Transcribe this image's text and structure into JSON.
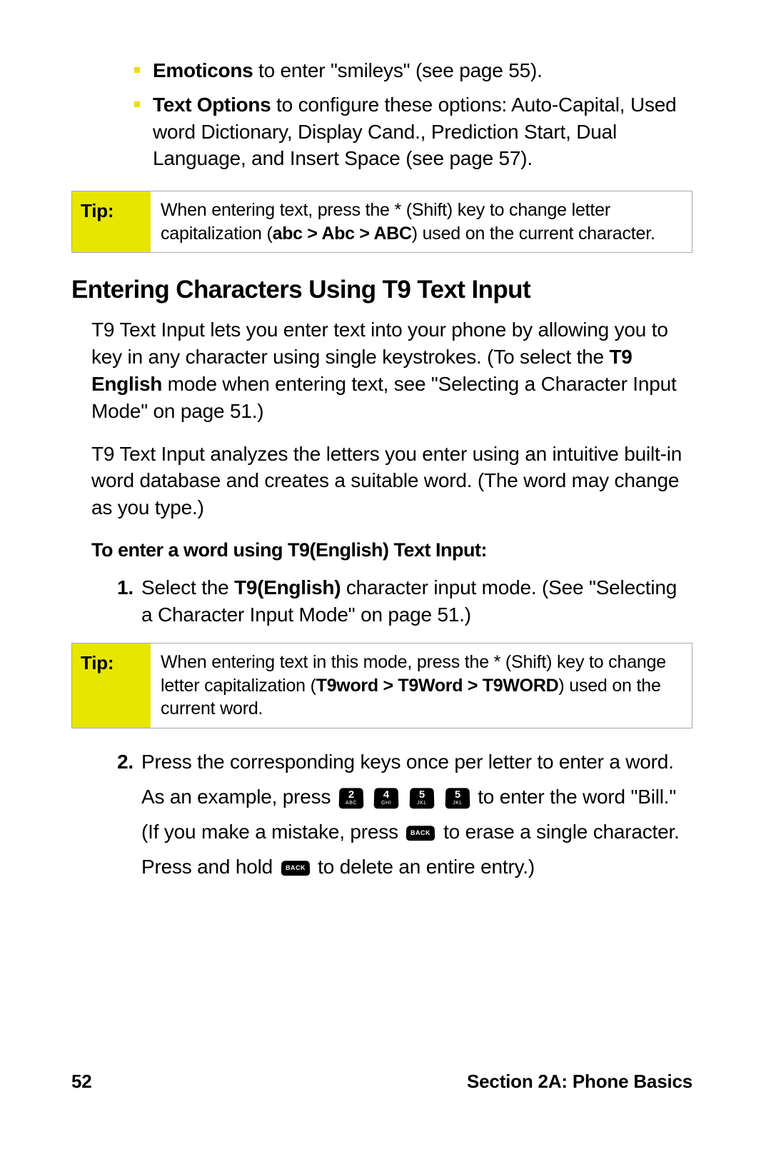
{
  "bullets": [
    {
      "bold": "Emoticons",
      "rest": " to enter \"smileys\" (see page 55)."
    },
    {
      "bold": "Text Options",
      "rest": " to configure these options: Auto-Capital, Used word Dictionary, Display Cand., Prediction Start, Dual Language, and Insert Space (see page 57)."
    }
  ],
  "tip1": {
    "label": "Tip:",
    "pre": "When entering text, press the * (Shift) key to change letter capitalization (",
    "bold": "abc > Abc > ABC",
    "post": ") used on the current character."
  },
  "heading": "Entering Characters Using T9 Text Input",
  "p1": {
    "pre": "T9 Text Input lets you enter text into your phone by allowing you to key in any character using single keystrokes. (To select the ",
    "bold": "T9 English",
    "post": " mode when entering text, see \"Selecting a Character Input Mode\" on page 51.)"
  },
  "p2": "T9 Text Input analyzes the letters you enter using an intuitive built-in word database and creates a suitable word. (The word may change as you type.)",
  "substep_head": "To enter a word using T9(English) Text Input:",
  "step1": {
    "num": "1.",
    "pre": "Select the ",
    "bold": "T9(English)",
    "post": " character input mode. (See \"Selecting a Character Input Mode\" on page 51.)"
  },
  "tip2": {
    "label": "Tip:",
    "pre": "When entering text in this mode, press the * (Shift) key to change letter capitalization (",
    "bold": "T9word > T9Word > T9WORD",
    "post": ") used on the current word."
  },
  "step2": {
    "num": "2.",
    "t1": "Press the corresponding keys once per letter to enter a word. As an example, press ",
    "t2": " to enter the word \"Bill.\" (If you make a mistake, press ",
    "t3": " to erase a single character. Press and hold ",
    "t4": " to delete an entire entry.)"
  },
  "keys": {
    "k2": {
      "big": "2",
      "sm": "ABC"
    },
    "k4": {
      "big": "4",
      "sm": "GHI"
    },
    "k5a": {
      "big": "5",
      "sm": "JKL"
    },
    "k5b": {
      "big": "5",
      "sm": "JKL"
    },
    "back1": {
      "sm": "BACK"
    },
    "back2": {
      "sm": "BACK"
    }
  },
  "footer": {
    "page": "52",
    "section": "Section 2A: Phone Basics"
  }
}
